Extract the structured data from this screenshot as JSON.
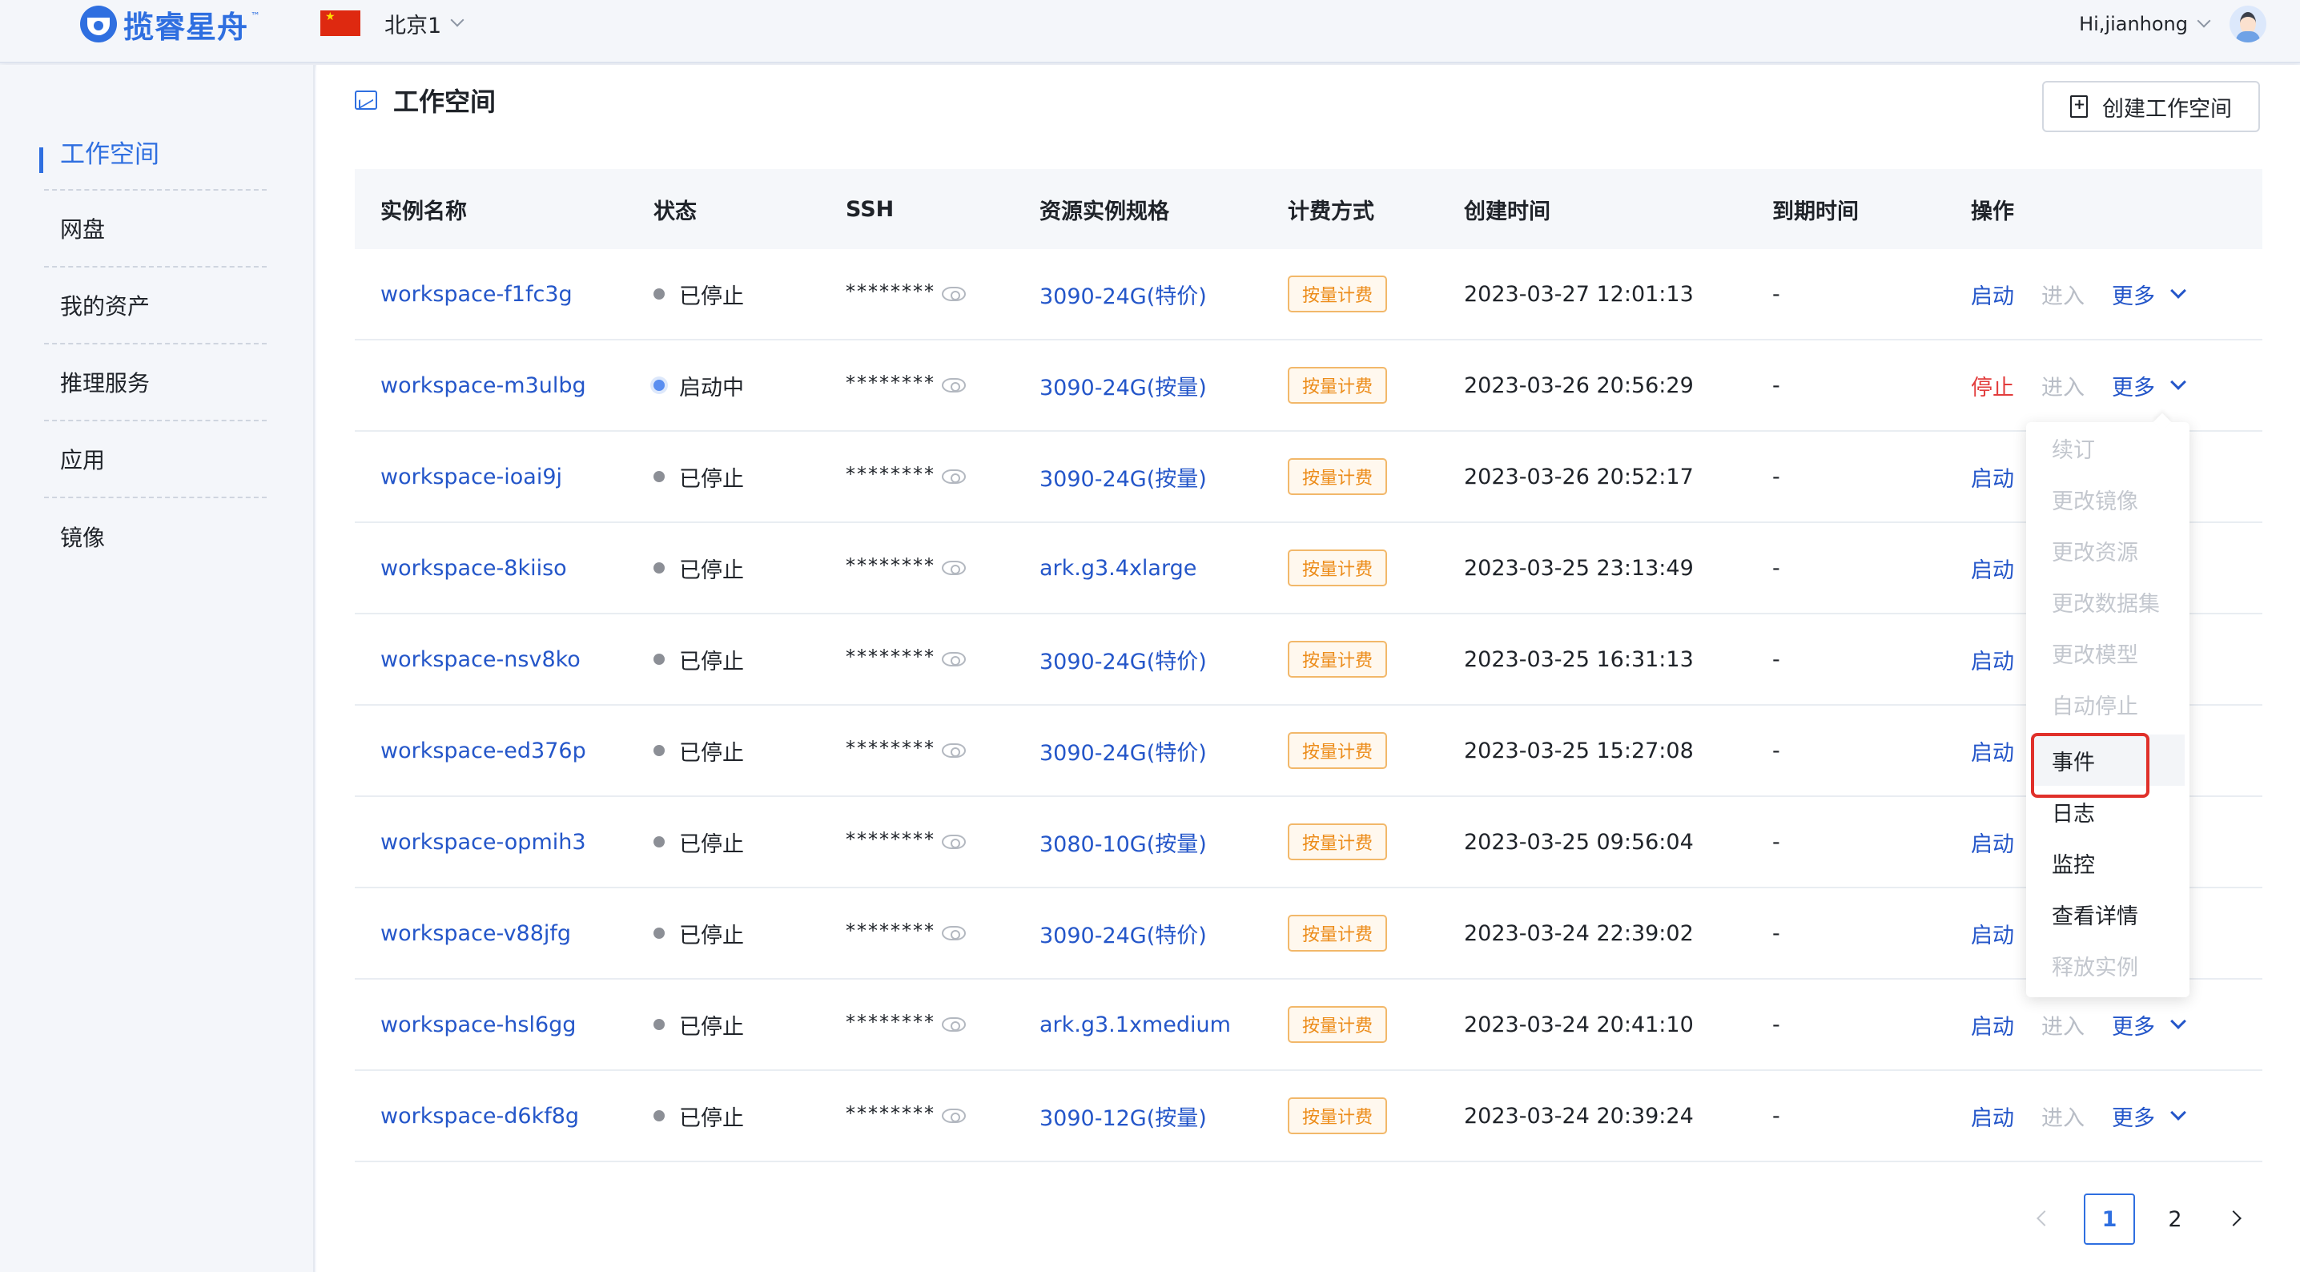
{
  "header": {
    "logo_text": "揽睿星舟",
    "logo_tm": "™",
    "region": "北京1",
    "user_greeting": "Hi,jianhong"
  },
  "sidebar": {
    "items": [
      {
        "label": "工作空间",
        "active": true
      },
      {
        "label": "网盘"
      },
      {
        "label": "我的资产"
      },
      {
        "label": "推理服务"
      },
      {
        "label": "应用"
      },
      {
        "label": "镜像"
      }
    ]
  },
  "page": {
    "title": "工作空间",
    "create_button": "创建工作空间"
  },
  "table": {
    "headers": [
      "实例名称",
      "状态",
      "SSH",
      "资源实例规格",
      "计费方式",
      "创建时间",
      "到期时间",
      "操作"
    ],
    "rows": [
      {
        "name": "workspace-f1fc3g",
        "status": "已停止",
        "ssh": "********",
        "spec": "3090-24G(特价)",
        "billing": "按量计费",
        "created": "2023-03-27 12:01:13",
        "expires": "-",
        "action": "启动",
        "enter": "进入",
        "more": "更多"
      },
      {
        "name": "workspace-m3ulbg",
        "status": "启动中",
        "ssh": "********",
        "spec": "3090-24G(按量)",
        "billing": "按量计费",
        "created": "2023-03-26 20:56:29",
        "expires": "-",
        "action": "停止",
        "enter": "进入",
        "more": "更多"
      },
      {
        "name": "workspace-ioai9j",
        "status": "已停止",
        "ssh": "********",
        "spec": "3090-24G(按量)",
        "billing": "按量计费",
        "created": "2023-03-26 20:52:17",
        "expires": "-",
        "action": "启动"
      },
      {
        "name": "workspace-8kiiso",
        "status": "已停止",
        "ssh": "********",
        "spec": "ark.g3.4xlarge",
        "billing": "按量计费",
        "created": "2023-03-25 23:13:49",
        "expires": "-",
        "action": "启动"
      },
      {
        "name": "workspace-nsv8ko",
        "status": "已停止",
        "ssh": "********",
        "spec": "3090-24G(特价)",
        "billing": "按量计费",
        "created": "2023-03-25 16:31:13",
        "expires": "-",
        "action": "启动"
      },
      {
        "name": "workspace-ed376p",
        "status": "已停止",
        "ssh": "********",
        "spec": "3090-24G(特价)",
        "billing": "按量计费",
        "created": "2023-03-25 15:27:08",
        "expires": "-",
        "action": "启动"
      },
      {
        "name": "workspace-opmih3",
        "status": "已停止",
        "ssh": "********",
        "spec": "3080-10G(按量)",
        "billing": "按量计费",
        "created": "2023-03-25 09:56:04",
        "expires": "-",
        "action": "启动"
      },
      {
        "name": "workspace-v88jfg",
        "status": "已停止",
        "ssh": "********",
        "spec": "3090-24G(特价)",
        "billing": "按量计费",
        "created": "2023-03-24 22:39:02",
        "expires": "-",
        "action": "启动"
      },
      {
        "name": "workspace-hsl6gg",
        "status": "已停止",
        "ssh": "********",
        "spec": "ark.g3.1xmedium",
        "billing": "按量计费",
        "created": "2023-03-24 20:41:10",
        "expires": "-",
        "action": "启动",
        "enter": "进入",
        "more": "更多"
      },
      {
        "name": "workspace-d6kf8g",
        "status": "已停止",
        "ssh": "********",
        "spec": "3090-12G(按量)",
        "billing": "按量计费",
        "created": "2023-03-24 20:39:24",
        "expires": "-",
        "action": "启动",
        "enter": "进入",
        "more": "更多"
      }
    ]
  },
  "more_menu": {
    "items": [
      {
        "label": "续订",
        "enabled": false
      },
      {
        "label": "更改镜像",
        "enabled": false
      },
      {
        "label": "更改资源",
        "enabled": false
      },
      {
        "label": "更改数据集",
        "enabled": false
      },
      {
        "label": "更改模型",
        "enabled": false
      },
      {
        "label": "自动停止",
        "enabled": false
      },
      {
        "label": "事件",
        "enabled": true,
        "highlighted": true
      },
      {
        "label": "日志",
        "enabled": true
      },
      {
        "label": "监控",
        "enabled": true
      },
      {
        "label": "查看详情",
        "enabled": true
      },
      {
        "label": "释放实例",
        "enabled": false
      }
    ]
  },
  "pagination": {
    "current": "1",
    "next_page": "2"
  },
  "colors": {
    "accent": "#2f6fe0",
    "link": "#2456c9",
    "stop": "#e23c3c",
    "billing_tag": "#ec8c1a",
    "highlight_box": "#e0302a"
  }
}
